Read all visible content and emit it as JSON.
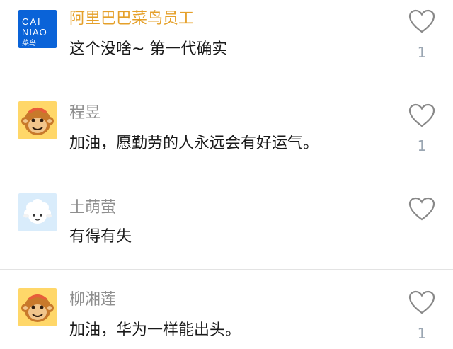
{
  "comments": [
    {
      "name": "阿里巴巴菜鸟员工",
      "text": "这个没啥~  第一代确实",
      "likes": "1",
      "avatar_icon": "cainiao-logo-icon",
      "avatar_text": "CAI NIAO 菜鸟"
    },
    {
      "name": "程昱",
      "text": "加油，愿勤劳的人永远会有好运气。",
      "likes": "1",
      "avatar_icon": "monkey-avatar-icon"
    },
    {
      "name": "土萌萤",
      "text": "有得有失",
      "likes": "",
      "avatar_icon": "sheep-avatar-icon"
    },
    {
      "name": "柳湘莲",
      "text": "加油，华为一样能出头。",
      "likes": "1",
      "avatar_icon": "monkey-avatar-icon"
    }
  ],
  "colors": {
    "official_name": "#e5a02a",
    "name": "#8e8e8e",
    "text": "#1a1a1a",
    "count": "#9aa6b2",
    "divider": "#e3e3e3"
  }
}
